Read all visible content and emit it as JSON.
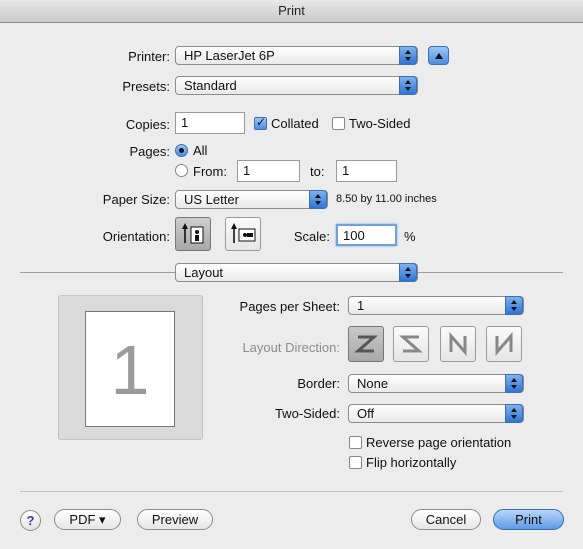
{
  "window": {
    "title": "Print"
  },
  "printer": {
    "label": "Printer:",
    "value": "HP LaserJet 6P"
  },
  "presets": {
    "label": "Presets:",
    "value": "Standard"
  },
  "copies": {
    "label": "Copies:",
    "value": "1",
    "collated_label": "Collated",
    "collated": true,
    "two_sided_label": "Two-Sided",
    "two_sided": false
  },
  "pages": {
    "label": "Pages:",
    "all_label": "All",
    "from_label": "From:",
    "from_value": "1",
    "to_label": "to:",
    "to_value": "1",
    "selected": "all"
  },
  "paper": {
    "label": "Paper Size:",
    "value": "US Letter",
    "dimensions": "8.50 by 11.00 inches"
  },
  "orientation": {
    "label": "Orientation:",
    "selected": "portrait"
  },
  "scale": {
    "label": "Scale:",
    "value": "100",
    "unit": "%"
  },
  "section": {
    "value": "Layout"
  },
  "preview": {
    "page_number": "1"
  },
  "layout": {
    "pages_per_sheet_label": "Pages per Sheet:",
    "pages_per_sheet": "1",
    "direction_label": "Layout Direction:",
    "border_label": "Border:",
    "border": "None",
    "two_sided_label": "Two-Sided:",
    "two_sided": "Off",
    "reverse_label": "Reverse page orientation",
    "reverse": false,
    "flip_label": "Flip horizontally",
    "flip": false
  },
  "footer": {
    "help": "?",
    "pdf_label": "PDF ▾",
    "preview_label": "Preview",
    "cancel_label": "Cancel",
    "print_label": "Print"
  }
}
